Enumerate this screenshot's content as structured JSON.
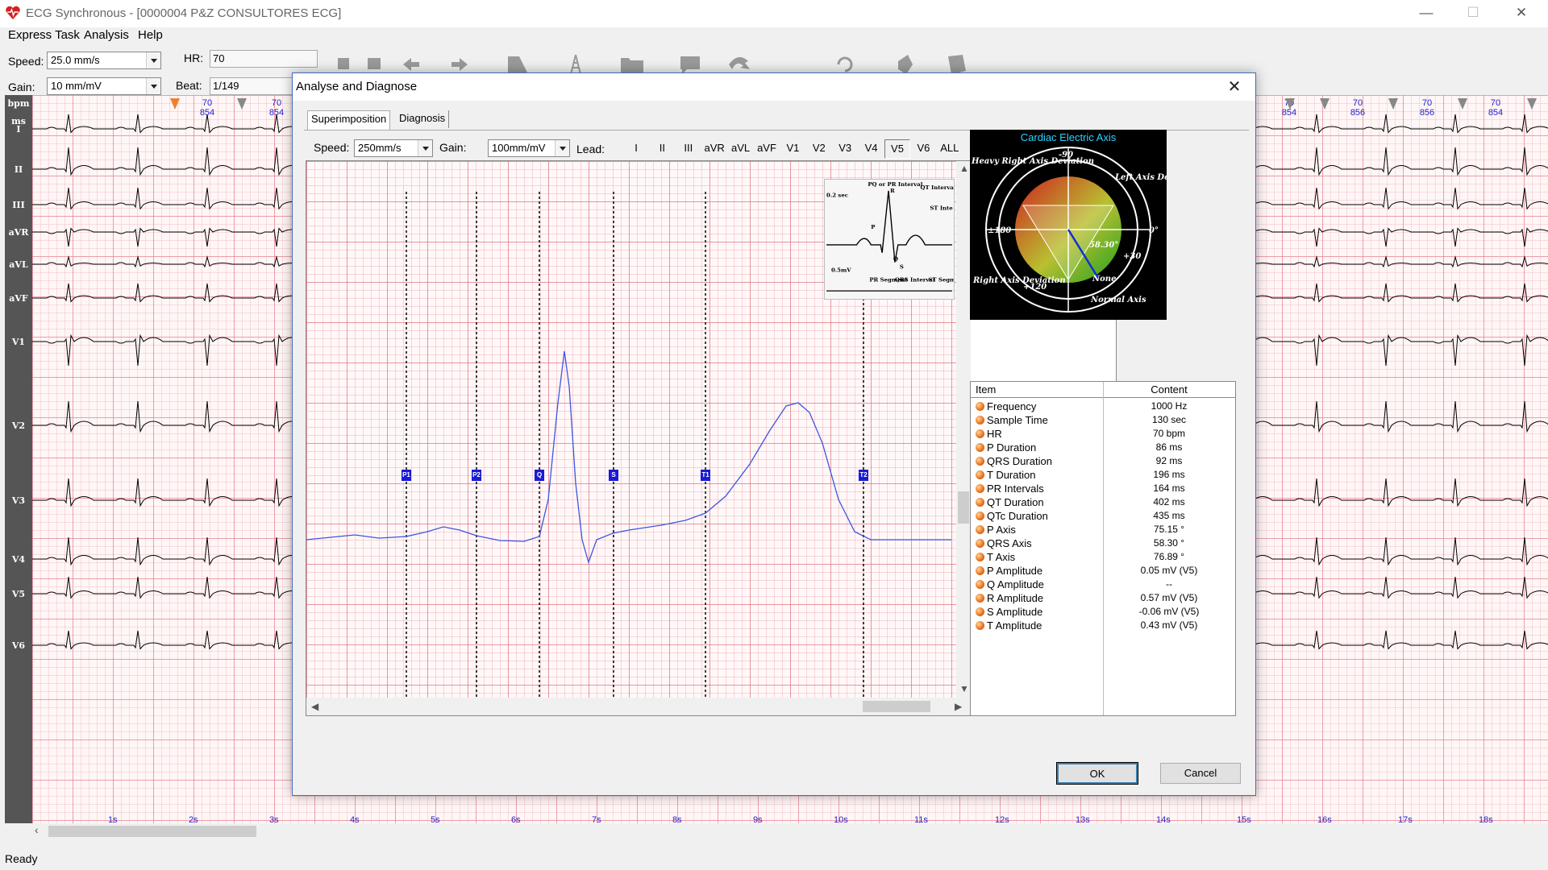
{
  "window": {
    "title": "ECG Synchronous - [0000004 P&Z CONSULTORES ECG]",
    "minimize": "—",
    "maximize": "☐",
    "close": "✕"
  },
  "menu": [
    "Express Task",
    "Analysis",
    "Help"
  ],
  "toolbar": {
    "speed_label": "Speed:",
    "speed_value": "25.0 mm/s",
    "gain_label": "Gain:",
    "gain_value": "10 mm/mV",
    "hr_label": "HR:",
    "hr_value": "70",
    "beat_label": "Beat:",
    "beat_value": "1/149",
    "icons": [
      "print-icon",
      "copy-icon",
      "arrow-left-icon",
      "arrow-right-icon",
      "ruler-icon",
      "tower-icon",
      "folder-icon",
      "chat-icon",
      "refresh-icon",
      "rotate-icon",
      "pin-icon",
      "tag-icon"
    ]
  },
  "ecg": {
    "ruler_labels": [
      "bpm",
      "ms"
    ],
    "leads": [
      "I",
      "II",
      "III",
      "aVR",
      "aVL",
      "aVF",
      "V1",
      "V2",
      "V3",
      "V4",
      "V5",
      "V6"
    ],
    "beats_left": [
      {
        "bpm": "70",
        "ms": "854"
      },
      {
        "bpm": "70",
        "ms": "854"
      }
    ],
    "beats_right": [
      {
        "bpm": "70",
        "ms": "854"
      },
      {
        "bpm": "70",
        "ms": "856"
      },
      {
        "bpm": "70",
        "ms": "856"
      },
      {
        "bpm": "70",
        "ms": "854"
      }
    ],
    "seconds": [
      "1s",
      "2s",
      "3s",
      "4s",
      "5s",
      "6s",
      "7s",
      "8s",
      "9s",
      "10s",
      "11s",
      "12s",
      "13s",
      "14s",
      "15s",
      "16s",
      "17s",
      "18s"
    ],
    "colors": {
      "grid_major": "#e16e7d",
      "trace": "#000000",
      "beat_text": "#2222cc"
    }
  },
  "status": "Ready",
  "dialog": {
    "title": "Analyse and Diagnose",
    "close": "✕",
    "tabs": [
      "Superimposition",
      "Diagnosis"
    ],
    "speed_label": "Speed:",
    "speed_value": "250mm/s",
    "gain_label": "Gain:",
    "gain_value": "100mm/mV",
    "lead_label": "Lead:",
    "lead_buttons": [
      "I",
      "II",
      "III",
      "aVR",
      "aVL",
      "aVF",
      "V1",
      "V2",
      "V3",
      "V4",
      "V5",
      "V6",
      "ALL"
    ],
    "active_lead": "V5",
    "markers": [
      "P1",
      "P2",
      "Q",
      "S",
      "T1",
      "T2"
    ],
    "reference_diagram": {
      "labels": [
        "0.2 sec",
        "PQ or PR Interval",
        "R",
        "QT Interval",
        "ST Inte",
        "P",
        "0.5mV",
        "Q",
        "S",
        "PR Segment",
        "QRS Interval",
        "ST Segment"
      ]
    },
    "axis_panel": {
      "title": "Cardiac Electric Axis",
      "labels": [
        "-90",
        "Heavy Right Axis Deviation",
        "Left Axis Deviation",
        "±180",
        "0°",
        "58.30°",
        "+30",
        "Right Axis Deviation",
        "+120",
        "None",
        "Normal Axis"
      ],
      "qrs_axis_deg": 58.3
    },
    "table": {
      "headers": [
        "Item",
        "Content"
      ],
      "rows": [
        {
          "item": "Frequency",
          "content": "1000 Hz"
        },
        {
          "item": "Sample Time",
          "content": "130 sec"
        },
        {
          "item": "HR",
          "content": "70 bpm"
        },
        {
          "item": "P Duration",
          "content": "86 ms"
        },
        {
          "item": "QRS Duration",
          "content": "92 ms"
        },
        {
          "item": "T Duration",
          "content": "196 ms"
        },
        {
          "item": "PR Intervals",
          "content": "164 ms"
        },
        {
          "item": "QT Duration",
          "content": "402 ms"
        },
        {
          "item": "QTc Duration",
          "content": "435 ms"
        },
        {
          "item": "P Axis",
          "content": "75.15 °"
        },
        {
          "item": "QRS Axis",
          "content": "58.30 °"
        },
        {
          "item": "T Axis",
          "content": "76.89 °"
        },
        {
          "item": "P Amplitude",
          "content": "0.05 mV (V5)"
        },
        {
          "item": "Q Amplitude",
          "content": "--"
        },
        {
          "item": "R Amplitude",
          "content": "0.57 mV (V5)"
        },
        {
          "item": "S Amplitude",
          "content": "-0.06 mV (V5)"
        },
        {
          "item": "T Amplitude",
          "content": "0.43 mV (V5)"
        }
      ]
    },
    "ok": "OK",
    "cancel": "Cancel"
  }
}
